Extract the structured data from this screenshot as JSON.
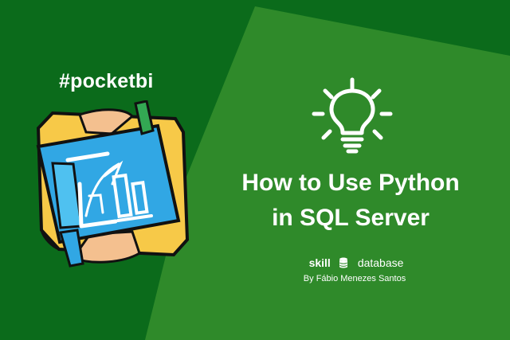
{
  "hashtag": "#pocketbi",
  "title": {
    "line1": "How to Use Python",
    "line2": "in SQL Server"
  },
  "brand": {
    "word1": "skill",
    "icon": "database-icon",
    "word2": "database"
  },
  "author": "By Fábio Menezes Santos",
  "colors": {
    "background": "#0b6b1b",
    "panel": "#2f8a2a",
    "text": "#ffffff",
    "logo_blue": "#31a7e4",
    "logo_yellow": "#f7c948",
    "logo_peach": "#f4c08f"
  },
  "icons": [
    "lightbulb-icon",
    "pocketbi-logo",
    "database-icon"
  ]
}
